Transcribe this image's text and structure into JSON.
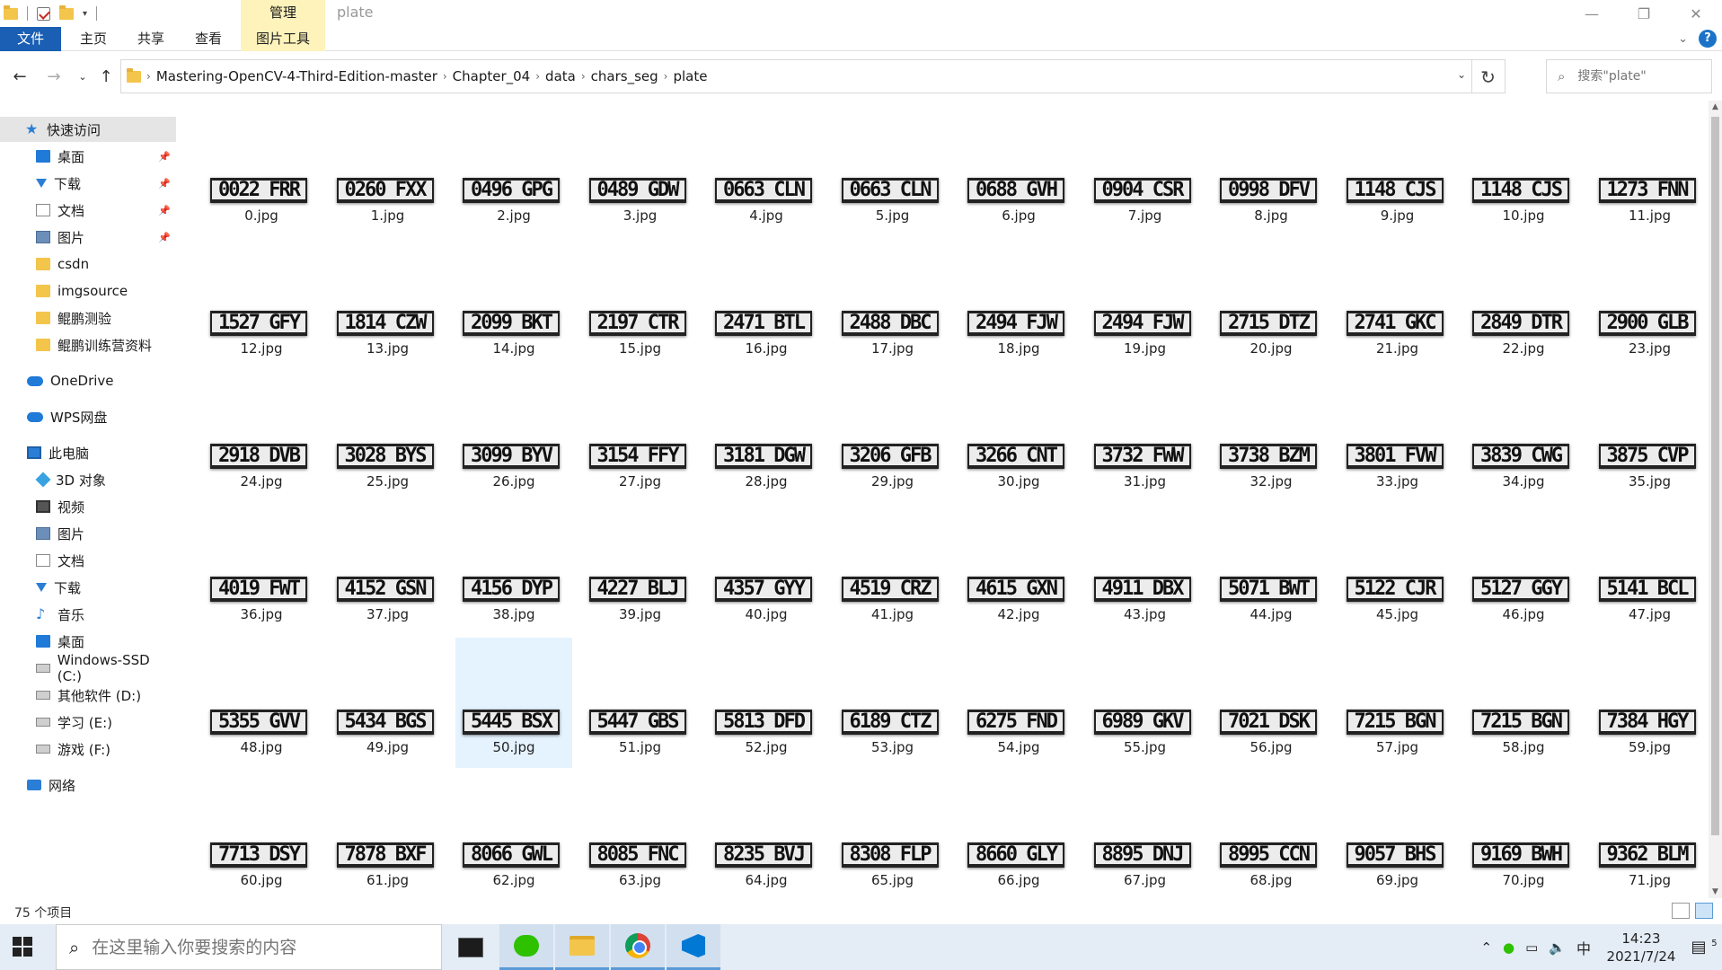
{
  "window": {
    "title": "plate",
    "ribbon_context_group": "管理",
    "tabs": [
      "文件",
      "主页",
      "共享",
      "查看",
      "图片工具"
    ]
  },
  "address": {
    "path": [
      "Mastering-OpenCV-4-Third-Edition-master",
      "Chapter_04",
      "data",
      "chars_seg",
      "plate"
    ],
    "search_placeholder": "搜索\"plate\""
  },
  "sidebar": {
    "quick_access": "快速访问",
    "pinned": [
      "桌面",
      "下载",
      "文档",
      "图片"
    ],
    "folders": [
      "csdn",
      "imgsource",
      "鲲鹏测验",
      "鲲鹏训练营资料"
    ],
    "onedrive": "OneDrive",
    "wps": "WPS网盘",
    "this_pc": "此电脑",
    "pc_items": [
      "3D 对象",
      "视频",
      "图片",
      "文档",
      "下载",
      "音乐",
      "桌面"
    ],
    "drives": [
      "Windows-SSD (C:)",
      "其他软件 (D:)",
      "学习 (E:)",
      "游戏 (F:)"
    ],
    "network": "网络"
  },
  "files": [
    {
      "name": "0.jpg",
      "plate": "0022 FRR"
    },
    {
      "name": "1.jpg",
      "plate": "0260 FXX"
    },
    {
      "name": "2.jpg",
      "plate": "0496 GPG"
    },
    {
      "name": "3.jpg",
      "plate": "0489 GDW"
    },
    {
      "name": "4.jpg",
      "plate": "0663 CLN"
    },
    {
      "name": "5.jpg",
      "plate": "0663 CLN"
    },
    {
      "name": "6.jpg",
      "plate": "0688 GVH"
    },
    {
      "name": "7.jpg",
      "plate": "0904 CSR"
    },
    {
      "name": "8.jpg",
      "plate": "0998 DFV"
    },
    {
      "name": "9.jpg",
      "plate": "1148 CJS"
    },
    {
      "name": "10.jpg",
      "plate": "1148 CJS"
    },
    {
      "name": "11.jpg",
      "plate": "1273 FNN"
    },
    {
      "name": "12.jpg",
      "plate": "1527 GFY"
    },
    {
      "name": "13.jpg",
      "plate": "1814 CZW"
    },
    {
      "name": "14.jpg",
      "plate": "2099 BKT"
    },
    {
      "name": "15.jpg",
      "plate": "2197 CTR"
    },
    {
      "name": "16.jpg",
      "plate": "2471 BTL"
    },
    {
      "name": "17.jpg",
      "plate": "2488 DBC"
    },
    {
      "name": "18.jpg",
      "plate": "2494 FJW"
    },
    {
      "name": "19.jpg",
      "plate": "2494 FJW"
    },
    {
      "name": "20.jpg",
      "plate": "2715 DTZ"
    },
    {
      "name": "21.jpg",
      "plate": "2741 GKC"
    },
    {
      "name": "22.jpg",
      "plate": "2849 DTR"
    },
    {
      "name": "23.jpg",
      "plate": "2900 GLB"
    },
    {
      "name": "24.jpg",
      "plate": "2918 DVB"
    },
    {
      "name": "25.jpg",
      "plate": "3028 BYS"
    },
    {
      "name": "26.jpg",
      "plate": "3099 BYV"
    },
    {
      "name": "27.jpg",
      "plate": "3154 FFY"
    },
    {
      "name": "28.jpg",
      "plate": "3181 DGW"
    },
    {
      "name": "29.jpg",
      "plate": "3206 GFB"
    },
    {
      "name": "30.jpg",
      "plate": "3266 CNT"
    },
    {
      "name": "31.jpg",
      "plate": "3732 FWW"
    },
    {
      "name": "32.jpg",
      "plate": "3738 BZM"
    },
    {
      "name": "33.jpg",
      "plate": "3801 FVW"
    },
    {
      "name": "34.jpg",
      "plate": "3839 CWG"
    },
    {
      "name": "35.jpg",
      "plate": "3875 CVP"
    },
    {
      "name": "36.jpg",
      "plate": "4019 FWT"
    },
    {
      "name": "37.jpg",
      "plate": "4152 GSN"
    },
    {
      "name": "38.jpg",
      "plate": "4156 DYP"
    },
    {
      "name": "39.jpg",
      "plate": "4227 BLJ"
    },
    {
      "name": "40.jpg",
      "plate": "4357 GYY"
    },
    {
      "name": "41.jpg",
      "plate": "4519 CRZ"
    },
    {
      "name": "42.jpg",
      "plate": "4615 GXN"
    },
    {
      "name": "43.jpg",
      "plate": "4911 DBX"
    },
    {
      "name": "44.jpg",
      "plate": "5071 BWT"
    },
    {
      "name": "45.jpg",
      "plate": "5122 CJR"
    },
    {
      "name": "46.jpg",
      "plate": "5127 GGY"
    },
    {
      "name": "47.jpg",
      "plate": "5141 BCL"
    },
    {
      "name": "48.jpg",
      "plate": "5355 GVV"
    },
    {
      "name": "49.jpg",
      "plate": "5434 BGS"
    },
    {
      "name": "50.jpg",
      "plate": "5445 BSX"
    },
    {
      "name": "51.jpg",
      "plate": "5447 GBS"
    },
    {
      "name": "52.jpg",
      "plate": "5813 DFD"
    },
    {
      "name": "53.jpg",
      "plate": "6189 CTZ"
    },
    {
      "name": "54.jpg",
      "plate": "6275 FND"
    },
    {
      "name": "55.jpg",
      "plate": "6989 GKV"
    },
    {
      "name": "56.jpg",
      "plate": "7021 DSK"
    },
    {
      "name": "57.jpg",
      "plate": "7215 BGN"
    },
    {
      "name": "58.jpg",
      "plate": "7215 BGN"
    },
    {
      "name": "59.jpg",
      "plate": "7384 HGY"
    },
    {
      "name": "60.jpg",
      "plate": "7713 DSY"
    },
    {
      "name": "61.jpg",
      "plate": "7878 BXF"
    },
    {
      "name": "62.jpg",
      "plate": "8066 GWL"
    },
    {
      "name": "63.jpg",
      "plate": "8085 FNC"
    },
    {
      "name": "64.jpg",
      "plate": "8235 BVJ"
    },
    {
      "name": "65.jpg",
      "plate": "8308 FLP"
    },
    {
      "name": "66.jpg",
      "plate": "8660 GLY"
    },
    {
      "name": "67.jpg",
      "plate": "8895 DNJ"
    },
    {
      "name": "68.jpg",
      "plate": "8995 CCN"
    },
    {
      "name": "69.jpg",
      "plate": "9057 BHS"
    },
    {
      "name": "70.jpg",
      "plate": "9169 BWH"
    },
    {
      "name": "71.jpg",
      "plate": "9362 BLM"
    }
  ],
  "selected_file": "50.jpg",
  "status": {
    "count": "75 个项目"
  },
  "taskbar": {
    "search_placeholder": "在这里输入你要搜索的内容",
    "ime": "中",
    "time": "14:23",
    "date": "2021/7/24",
    "notification_count": "5"
  }
}
